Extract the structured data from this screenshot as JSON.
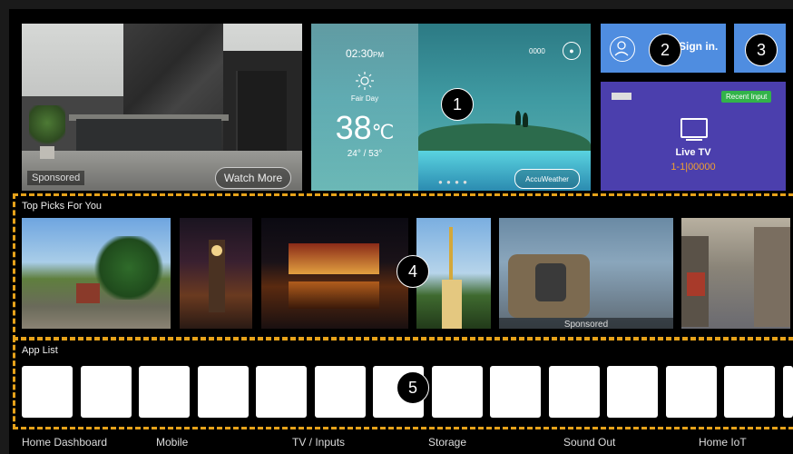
{
  "hero": {
    "tag": "Sponsored",
    "button": "Watch More"
  },
  "weather": {
    "time": "02:30",
    "time_suffix": "PM",
    "condition": "Fair Day",
    "temperature": "38",
    "unit": "℃",
    "range": "24° / 53°",
    "location": "0000",
    "provider": "AccuWeather"
  },
  "signin": {
    "label": "Sign in."
  },
  "live": {
    "badge": "Recent Input",
    "name": "Live TV",
    "channel": "1-1|00000"
  },
  "markers": [
    "1",
    "2",
    "3",
    "4",
    "5"
  ],
  "top_picks": {
    "title": "Top Picks For You",
    "sponsored": "Sponsored"
  },
  "app_list": {
    "title": "App List",
    "tile_count": 14
  },
  "bottom_nav": [
    "Home Dashboard",
    "Mobile",
    "TV / Inputs",
    "Storage",
    "Sound Out",
    "Home IoT"
  ],
  "colors": {
    "accent_dash": "#e6a21a",
    "tile_blue": "#4f8de0",
    "live_tv": "#4b3fad",
    "recent_badge": "#32b34a"
  }
}
